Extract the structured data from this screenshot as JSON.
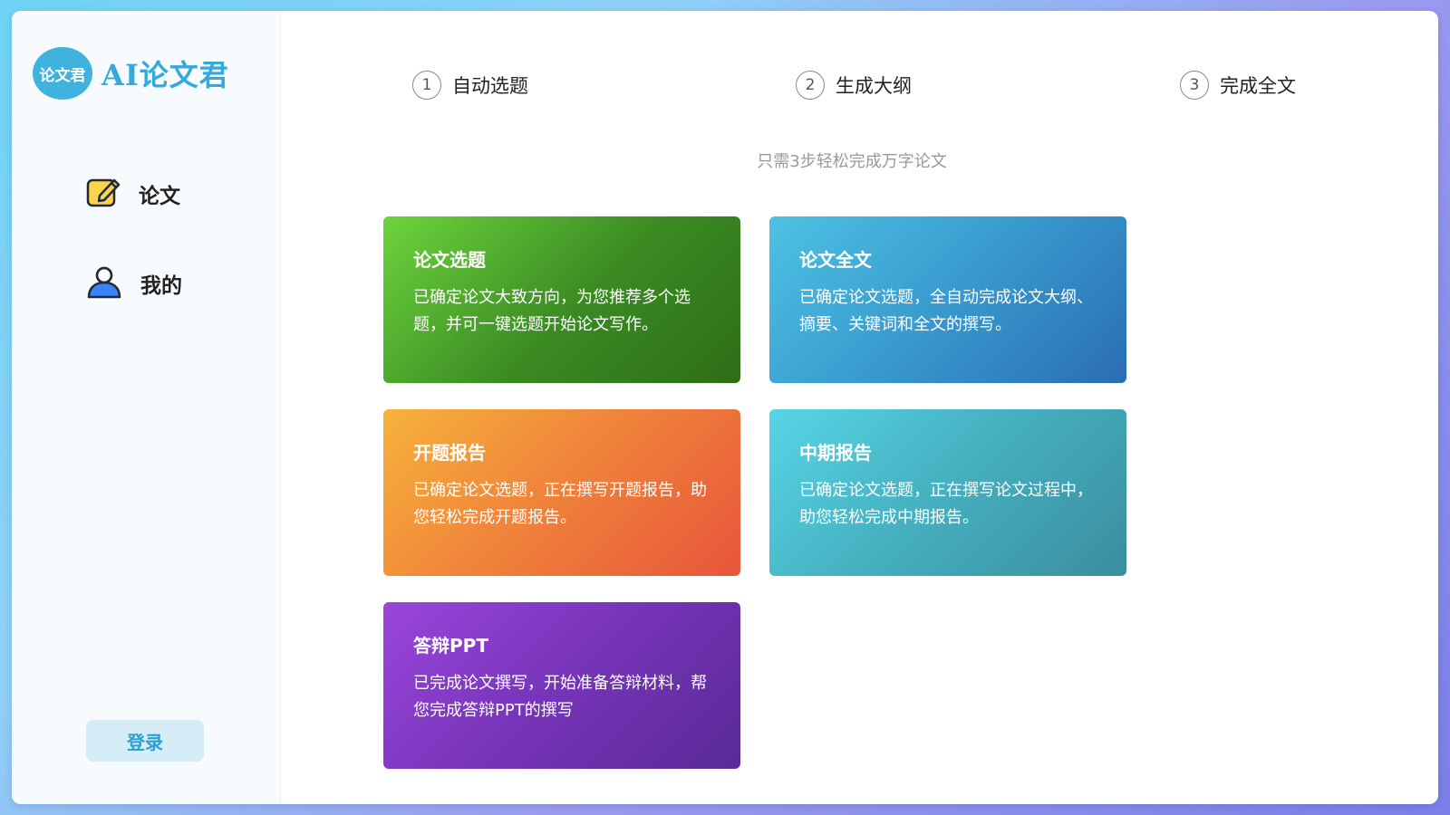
{
  "brand": {
    "badge_text": "论文君",
    "name": "AI论文君",
    "accent_color": "#36a9db"
  },
  "sidebar": {
    "items": [
      {
        "label": "论文",
        "icon": "edit-paper-icon"
      },
      {
        "label": "我的",
        "icon": "user-icon"
      }
    ],
    "login_label": "登录"
  },
  "steps": [
    {
      "num": "1",
      "label": "自动选题"
    },
    {
      "num": "2",
      "label": "生成大纲"
    },
    {
      "num": "3",
      "label": "完成全文"
    }
  ],
  "subtitle": "只需3步轻松完成万字论文",
  "cards": [
    {
      "title": "论文选题",
      "desc": "已确定论文大致方向，为您推荐多个选题，并可一键选题开始论文写作。",
      "color": "#3a8a22"
    },
    {
      "title": "论文全文",
      "desc": "已确定论文选题，全自动完成论文大纲、摘要、关键词和全文的撰写。",
      "color": "#3a9ed0"
    },
    {
      "title": "开题报告",
      "desc": "已确定论文选题，正在撰写开题报告，助您轻松完成开题报告。",
      "color": "#f0853a"
    },
    {
      "title": "中期报告",
      "desc": "已确定论文选题，正在撰写论文过程中，助您轻松完成中期报告。",
      "color": "#46b2c2"
    },
    {
      "title": "答辩PPT",
      "desc": "已完成论文撰写，开始准备答辩材料，帮您完成答辩PPT的撰写",
      "color": "#7634b8"
    }
  ]
}
